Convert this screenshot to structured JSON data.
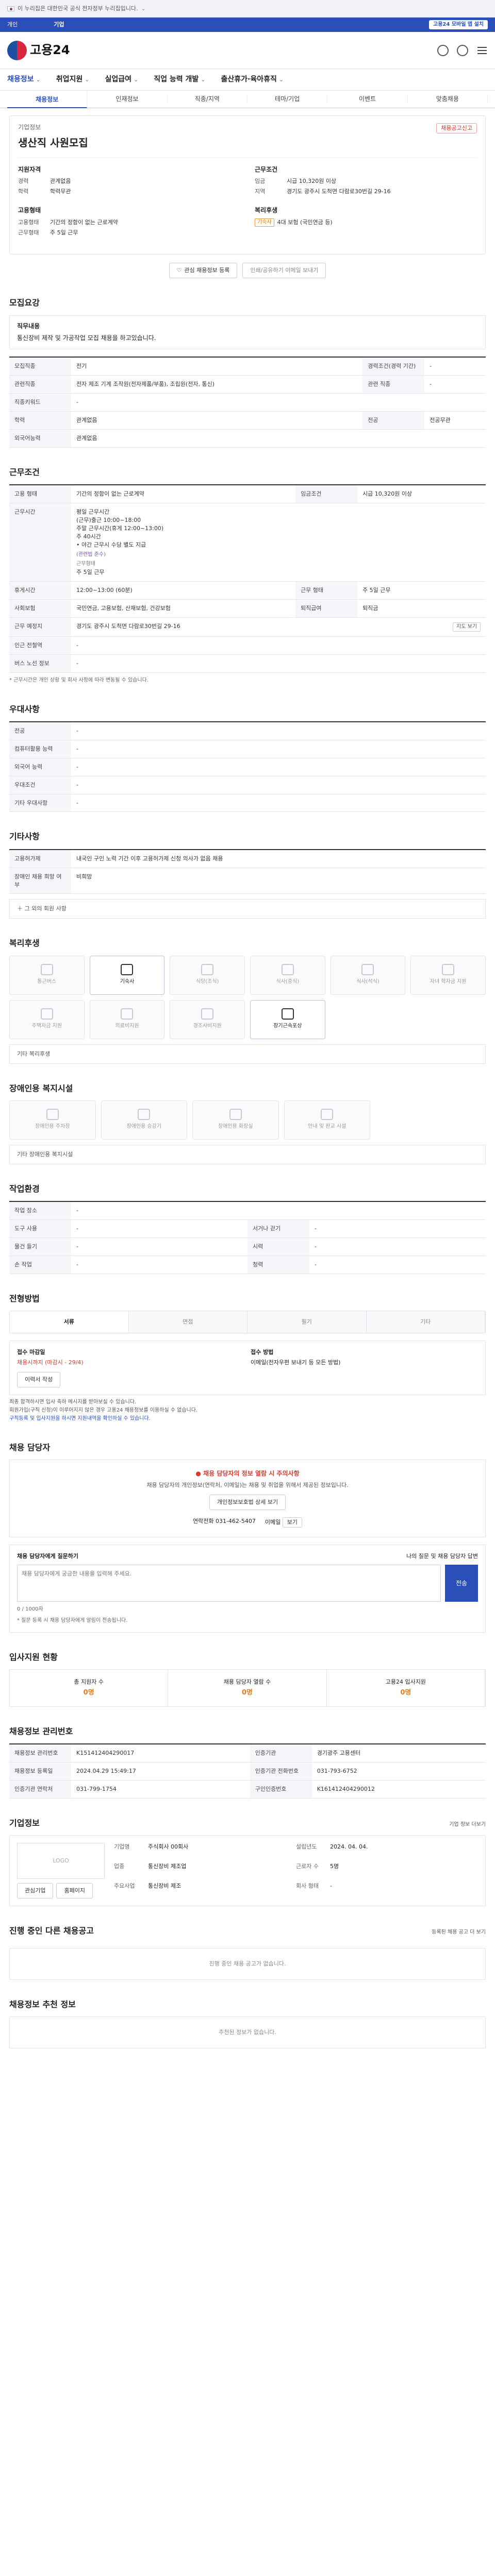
{
  "gov": {
    "banner": "이 누리집은 대한민국 공식 전자정부 누리집입니다."
  },
  "topbar": {
    "link": "기업",
    "right": "고용24 모바일 앱 설치"
  },
  "header": {
    "logo": "고용24"
  },
  "gnb": [
    "채용정보",
    "취업지원",
    "실업급여",
    "직업 능력 개발",
    "출산휴가·육아휴직"
  ],
  "subnav": [
    "채용정보",
    "인재정보",
    "직종/지역",
    "테마/기업",
    "이벤트",
    "맞춤채용"
  ],
  "job": {
    "company_label": "기업정보",
    "title": "생산직 사원모집",
    "report": "채용공고신고",
    "summary_left_title": "지원자격",
    "summary_right_title": "근무조건",
    "left_rows": [
      {
        "k": "경력",
        "v": "관계없음"
      },
      {
        "k": "학력",
        "v": "학력무관"
      },
      {
        "k": "",
        "v": ""
      }
    ],
    "right_rows": [
      {
        "k": "임금",
        "v": "시급 10,320원 이상"
      },
      {
        "k": "지역",
        "v": "경기도 광주시 도척면 다람로30번길 29-16"
      }
    ],
    "left2_title": "고용형태",
    "left2_rows": [
      {
        "k": "고용형태",
        "v": "기간의 정함이 없는 근로계약"
      },
      {
        "k": "근무형태",
        "v": "주 5일 근무"
      }
    ],
    "right2_title": "복리후생",
    "right2_badge": "기숙사",
    "right2_rows": [
      {
        "k": "",
        "v": "4대 보험 (국민연금 등)"
      }
    ],
    "btn_interest": "관심 채용정보 등록",
    "btn_print": "인쇄/공유하기 이메일 보내기"
  },
  "s_apply": {
    "title": "모집요강",
    "box_t": "직무내용",
    "box_v": "통신장비 제작 및 가공작업 모집 채용을 하고있습니다."
  },
  "s_apply_tb": [
    {
      "k": "모집직종",
      "v": "전기",
      "k2": "경력조건(경력 기간)",
      "v2": "-"
    },
    {
      "k": "관련직종",
      "v": "전자 제조 기계 조작원(전자제품/부품), 조립원(전자, 통신)",
      "k2": "관련 직종",
      "v2": "-"
    },
    {
      "k": "직종키워드",
      "v": "-",
      "k2": "",
      "v2": ""
    },
    {
      "k": "학력",
      "v": "관계없음",
      "k2": "전공",
      "v2": "전공무관"
    },
    {
      "k": "외국어능력",
      "v": "관계없음",
      "k2": "",
      "v2": ""
    }
  ],
  "s_cond": {
    "title": "근무조건"
  },
  "s_cond_tb": {
    "emp_type": "기간의 정함이 없는 근로계약",
    "pay_k": "임금조건",
    "pay": "시급 10,320원 이상",
    "hours_k": "근무시간",
    "hours": "시간 10:00~18:00",
    "hours_lines": [
      "평일 근무시간",
      "(근무)출근 10:00~18:00",
      "주말 근무시간(휴게 12:00~13:00)",
      "주 40시간",
      "• 야간 근무시 수당 별도 지급"
    ],
    "hours_note": "(관련법 준수)",
    "shift": "근무형태",
    "shift_v": "주 5일 근무",
    "work_days_k": "휴게시간",
    "work_days": "12:00~13:00 (60분)",
    "break_k": "근무 형태",
    "break": "주 5일 근무",
    "insurance_k": "사회보험",
    "insurance": "국민연금, 고용보험, 산재보험, 건강보험",
    "retire_k": "퇴직급여",
    "retire": "퇴직금",
    "addr_k": "근무 예정지",
    "addr": "경기도 광주시 도척면 다람로30번길 29-16",
    "map": "지도 보기",
    "line_k": "인근 전철역",
    "line": "-",
    "bus_k": "버스 노선 정보",
    "bus": "-",
    "note": "* 근무시간은 개인 상황 및 회사 사정에 따라 변동될 수 있습니다."
  },
  "s_period": {
    "title": "우대사항",
    "rows": [
      {
        "k": "전공",
        "v": "-"
      },
      {
        "k": "컴퓨터활용 능력",
        "v": "-"
      },
      {
        "k": "외국어 능력",
        "v": "-"
      },
      {
        "k": "우대조건",
        "v": "-"
      },
      {
        "k": "기타 우대사항",
        "v": "-"
      }
    ]
  },
  "s_etc": {
    "title": "기타사항",
    "rows": [
      {
        "k": "고용허가제",
        "v": "내국인 구인 노력 기간 이후 고용허가제 신청 의사가 없음 채용"
      },
      {
        "k": "장애인 채용 희망 여부",
        "v": "비희망"
      }
    ],
    "plus": "그 외의 회원 사항"
  },
  "s_welfare": {
    "title": "복리후생",
    "items": [
      "통근버스",
      "기숙사",
      "식당(조식)",
      "식사(중식)",
      "식사(석식)",
      "자녀 학자금 지원",
      "주택자금 지원",
      "의료비지원",
      "경조사비지원",
      "장기근속포상"
    ],
    "plus": "기타 복리후생"
  },
  "s_disab": {
    "title": "장애인용 복지시설",
    "items": [
      "장애인용 주차장",
      "장애인용 승강기",
      "장애인용 화장실",
      "안내 및 판교 시설"
    ],
    "plus": "기타 장애인용 복지시설"
  },
  "s_env": {
    "title": "작업환경",
    "rows": [
      {
        "k": "작업 장소",
        "v": "-",
        "k2": "",
        "v2": ""
      },
      {
        "k": "도구 사용",
        "v": "-",
        "k2": "서거나 걷기",
        "v2": "-"
      },
      {
        "k": "물건 들기",
        "v": "-",
        "k2": "시력",
        "v2": "-"
      },
      {
        "k": "손 작업",
        "v": "-",
        "k2": "청력",
        "v2": "-"
      }
    ]
  },
  "s_method": {
    "title": "전형방법",
    "tabs": [
      "서류",
      "면접",
      "필기",
      "기타"
    ],
    "apply_k": "접수 마감일",
    "apply_v": "채용시까지 (마감시 - 29/4)",
    "way_k": "접수 방법",
    "way_v": "이메일(전자우편 보내기 등 모든 방법)",
    "btn": "이력서 작성",
    "bullets": [
      "최종 합격하시면 입사 축하 메시지를 받아보실 수 있습니다.",
      "회원가입(구직 신청)이 이루어지지 않은 경우 고용24 채용정보를 이용하실 수 없습니다.",
      "구직등록 및 입사지원을 하시면 지원내역을 확인하실 수 있습니다."
    ]
  },
  "s_contact": {
    "title": "채용 담당자",
    "warn": "채용 담당자의 정보 열람 시 주의사항",
    "p": "채용 담당자의 개인정보(연락처, 이메일)는 채용 및 취업을 위해서 제공된 정보입니다.",
    "btn": "개인정보보호법 상세 보기",
    "tel_k": "연락전화",
    "tel": "031-462-5407",
    "mail_k": "이메일",
    "mail_btn": "보기"
  },
  "s_qa": {
    "title": "채용 담당자에게 질문하기",
    "right": "나의 질문 및 채용 담당자 답변",
    "placeholder": "채용 담당자에게 궁금한 내용을 입력해 주세요.",
    "count": "0 / 1000자",
    "send": "전송",
    "note": "* 질문 등록 시 채용 담당자에게 알림이 전송됩니다."
  },
  "s_status": {
    "title": "입사지원 현황",
    "items": [
      {
        "k": "총 지원자 수",
        "v": "0명"
      },
      {
        "k": "채용 담당자 열람 수",
        "v": "0명"
      },
      {
        "k": "고용24 입사지원",
        "v": "0명"
      }
    ]
  },
  "s_manage": {
    "title": "채용정보 관리번호",
    "rows": [
      {
        "k": "채용정보 관리번호",
        "v": "K151412404290017",
        "k2": "인증기관",
        "v2": "경기광주 고용센터"
      },
      {
        "k": "채용정보 등록일",
        "v": "2024.04.29 15:49:17",
        "k2": "인증기관 전화번호",
        "v2": "031-793-6752"
      },
      {
        "k": "인증기관 연락처",
        "v": "031-799-1754",
        "k2": "구인인증번호",
        "v2": "K161412404290012"
      }
    ]
  },
  "s_company": {
    "title": "기업정보",
    "more": "기업 정보 더보기",
    "logo": "LOGO",
    "rows": [
      {
        "k": "기업명",
        "v": "주식회사 00회사",
        "k2": "설립년도",
        "v2": "2024. 04. 04."
      },
      {
        "k": "업종",
        "v": "통신장비 제조업",
        "k2": "근로자 수",
        "v2": "5명"
      },
      {
        "k": "주요사업",
        "v": "통신장비 제조",
        "k2": "회사 형태",
        "v2": "-"
      }
    ],
    "btns": [
      "관심기업",
      "홈페이지"
    ]
  },
  "s_same": {
    "title": "진행 중인 다른 채용공고",
    "right": "등록된 채용 공고 더 보기",
    "empty": "진행 중인 채용 공고가 없습니다."
  },
  "s_reco": {
    "title": "채용정보 추천 정보",
    "empty": "추천된 정보가 없습니다."
  }
}
